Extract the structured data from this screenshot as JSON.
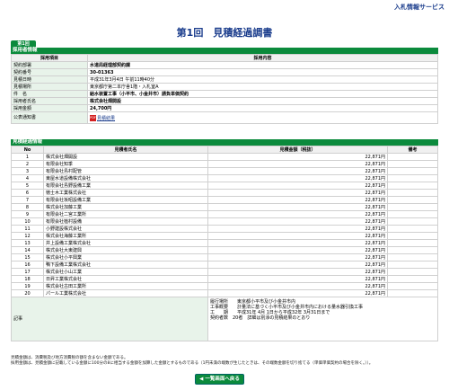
{
  "header": {
    "service": "入札情報サービス",
    "title": "第1回　見積経過調書",
    "tab": "第1回"
  },
  "saiyou": {
    "section_title": "採用者情報",
    "col_item": "採用項目",
    "col_content": "採用内容",
    "rows": [
      {
        "label": "契約部署",
        "value": "水道局経理部契約課"
      },
      {
        "label": "契約番号",
        "value": "30-01363"
      },
      {
        "label": "見積日時",
        "value": "平成31年3月4日 午前11時40分"
      },
      {
        "label": "見積場所",
        "value": "東京都庁第二本庁舎1階・入札室A"
      },
      {
        "label": "件　名",
        "value": "給水装置工事（小平市、小金井市）請負単価契約"
      },
      {
        "label": "採用者氏名",
        "value": "株式会社畑開設"
      },
      {
        "label": "採用金額",
        "value": "24,700円"
      }
    ],
    "notice_label": "公表通知書",
    "notice_link": "見積結果"
  },
  "keika": {
    "section_title": "見積経過情報",
    "col_no": "No",
    "col_name": "見積者氏名",
    "col_amount": "見積金額（税抜）",
    "col_note": "備考",
    "rows": [
      {
        "no": "1",
        "name": "株式会社畑開設",
        "amount": "22,871円"
      },
      {
        "no": "2",
        "name": "有限会社知季",
        "amount": "22,871円"
      },
      {
        "no": "3",
        "name": "有限会社島村配管",
        "amount": "22,871円"
      },
      {
        "no": "4",
        "name": "東屋水道設備株式会社",
        "amount": "22,871円"
      },
      {
        "no": "5",
        "name": "有限会社島野設備工業",
        "amount": "22,871円"
      },
      {
        "no": "6",
        "name": "徳士木工業株式会社",
        "amount": "22,871円"
      },
      {
        "no": "7",
        "name": "有限会社坂昭設備工業",
        "amount": "22,871円"
      },
      {
        "no": "8",
        "name": "株式会社加藤工業",
        "amount": "22,871円"
      },
      {
        "no": "9",
        "name": "有限会社二宮工業所",
        "amount": "22,871円"
      },
      {
        "no": "10",
        "name": "有限会社植村設備",
        "amount": "22,871円"
      },
      {
        "no": "11",
        "name": "小野建設株式会社",
        "amount": "22,871円"
      },
      {
        "no": "12",
        "name": "株式会社海藤工業所",
        "amount": "22,871円"
      },
      {
        "no": "13",
        "name": "井上設備工業株式会社",
        "amount": "22,871円"
      },
      {
        "no": "14",
        "name": "株式会社大東建興",
        "amount": "22,871円"
      },
      {
        "no": "15",
        "name": "株式会社小平興業",
        "amount": "22,871円"
      },
      {
        "no": "16",
        "name": "鴨下設備工業株式会社",
        "amount": "22,871円"
      },
      {
        "no": "17",
        "name": "株式会社小山工業",
        "amount": "22,871円"
      },
      {
        "no": "18",
        "name": "日昇工業株式会社",
        "amount": "22,871円"
      },
      {
        "no": "19",
        "name": "株式会社古田工業所",
        "amount": "22,871円"
      },
      {
        "no": "20",
        "name": "パール工業株式会社",
        "amount": "22,871円"
      }
    ],
    "remarks_label": "記事",
    "remarks": [
      "履行場所　　東京都小平市及び小金井市内",
      "工事概要　　計量法に基づく小平市及び小金井市内における量水器引換工事",
      "工　　期　　平成31年 4月 1日から平成32年 3月31日まで",
      "",
      "契約者数　20者　詳細は別添の見積結果のとおり"
    ]
  },
  "footer": {
    "note1": "見積金額は、消費税及び地方消費税の額を含まない金額である。",
    "note2": "採用金額は、見積金額に記載している金額に100分の8に相当する金額を加算した金額とするものである（1円未満の端数が生じたときは、その端数金額を切り捨てる（単価単価契約の場合を除く。））。",
    "back_label": "◀ 一覧画面へ戻る"
  }
}
